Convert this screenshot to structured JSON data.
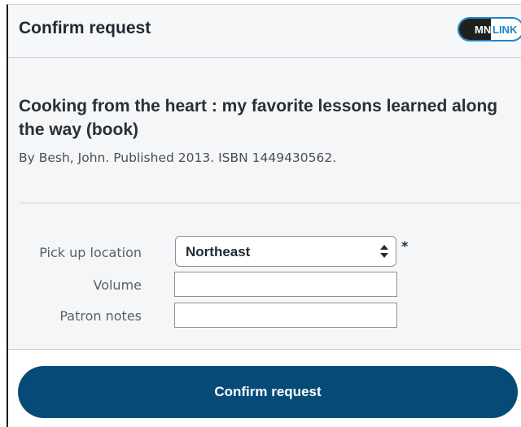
{
  "header": {
    "title": "Confirm request",
    "logo_text_left": "MN",
    "logo_text_right": "LINK",
    "logo_colors": {
      "dark": "#1f1f1f",
      "accent": "#1e86c8"
    }
  },
  "book": {
    "title": "Cooking from the heart : my favorite lessons learned along the way (book)",
    "meta": "By Besh, John. Published 2013. ISBN 1449430562."
  },
  "form": {
    "pickup_label": "Pick up location",
    "pickup_value": "Northeast",
    "required_mark": "*",
    "volume_label": "Volume",
    "volume_value": "",
    "notes_label": "Patron notes",
    "notes_value": ""
  },
  "footer": {
    "confirm_label": "Confirm request",
    "button_color": "#064b78"
  }
}
